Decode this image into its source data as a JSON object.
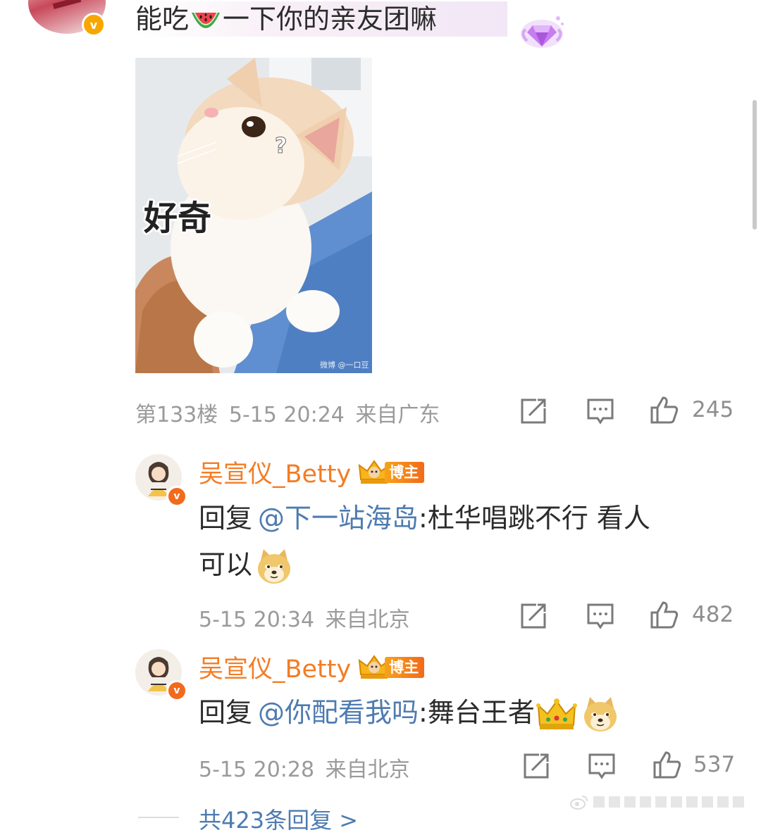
{
  "top_comment": {
    "text_before": "能吃",
    "text_after": "一下你的亲友团嘛",
    "floor": "第133楼",
    "time": "5-15 20:24",
    "location": "来自广东",
    "likes": "245",
    "image_caption": "好奇",
    "image_watermark": "微博 @一口豆"
  },
  "replies": [
    {
      "username": "吴宣仪_Betty",
      "badge": "博主",
      "reply_prefix": "回复",
      "mention": "@下一站海岛",
      "text_line1": ":杜华唱跳不行 看人",
      "text_line2": "可以",
      "time": "5-15 20:34",
      "location": "来自北京",
      "likes": "482"
    },
    {
      "username": "吴宣仪_Betty",
      "badge": "博主",
      "reply_prefix": "回复",
      "mention": "@你配看我吗",
      "text_line1": ":舞台王者",
      "time": "5-15 20:28",
      "location": "来自北京",
      "likes": "537"
    }
  ],
  "more_replies": "共423条回复 >",
  "colors": {
    "username": "#f47c23",
    "mention": "#4e7bb0",
    "meta": "#9a9a9a",
    "badge": "#f7a21b"
  },
  "icons": [
    "verified-icon",
    "watermelon-icon",
    "diamond-icon",
    "share-icon",
    "comment-icon",
    "like-icon",
    "doge-icon",
    "crown-icon",
    "weibo-logo-icon"
  ]
}
